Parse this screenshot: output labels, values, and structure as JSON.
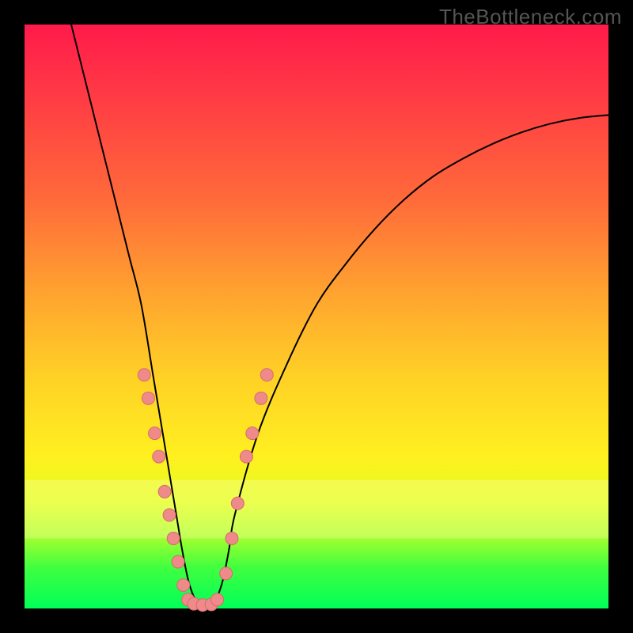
{
  "watermark": "TheBottleneck.com",
  "chart_data": {
    "type": "line",
    "title": "",
    "xlabel": "",
    "ylabel": "",
    "xlim": [
      0,
      100
    ],
    "ylim": [
      0,
      100
    ],
    "grid": false,
    "legend": false,
    "annotations": [],
    "series": [
      {
        "name": "bottleneck-curve",
        "x": [
          8,
          10,
          12,
          14,
          16,
          18,
          20,
          22,
          23,
          24,
          25,
          26,
          27,
          28,
          29,
          30,
          31,
          32,
          33,
          34,
          35,
          36,
          40,
          45,
          50,
          55,
          60,
          65,
          70,
          75,
          80,
          85,
          90,
          95,
          100
        ],
        "y": [
          100,
          92,
          84,
          76,
          68,
          60,
          52,
          40,
          34,
          28,
          22,
          16,
          10,
          5,
          2,
          0.5,
          0.5,
          0.5,
          2,
          5,
          10,
          16,
          30,
          42,
          52,
          59,
          65,
          70,
          74,
          77,
          79.5,
          81.5,
          83,
          84,
          84.5
        ]
      }
    ],
    "markers": {
      "name": "highlighted-points",
      "points": [
        {
          "x": 20.5,
          "y": 40
        },
        {
          "x": 21.2,
          "y": 36
        },
        {
          "x": 22.3,
          "y": 30
        },
        {
          "x": 23.0,
          "y": 26
        },
        {
          "x": 24.0,
          "y": 20
        },
        {
          "x": 24.8,
          "y": 16
        },
        {
          "x": 25.5,
          "y": 12
        },
        {
          "x": 26.3,
          "y": 8
        },
        {
          "x": 27.2,
          "y": 4
        },
        {
          "x": 28.0,
          "y": 1.5
        },
        {
          "x": 29.0,
          "y": 0.8
        },
        {
          "x": 30.5,
          "y": 0.6
        },
        {
          "x": 32.0,
          "y": 0.7
        },
        {
          "x": 33.0,
          "y": 1.5
        },
        {
          "x": 34.5,
          "y": 6
        },
        {
          "x": 35.5,
          "y": 12
        },
        {
          "x": 36.5,
          "y": 18
        },
        {
          "x": 38.0,
          "y": 26
        },
        {
          "x": 39.0,
          "y": 30
        },
        {
          "x": 40.5,
          "y": 36
        },
        {
          "x": 41.5,
          "y": 40
        }
      ]
    },
    "bands": [
      {
        "name": "pale-yellow-band",
        "y_from": 12,
        "y_to": 22
      }
    ]
  }
}
